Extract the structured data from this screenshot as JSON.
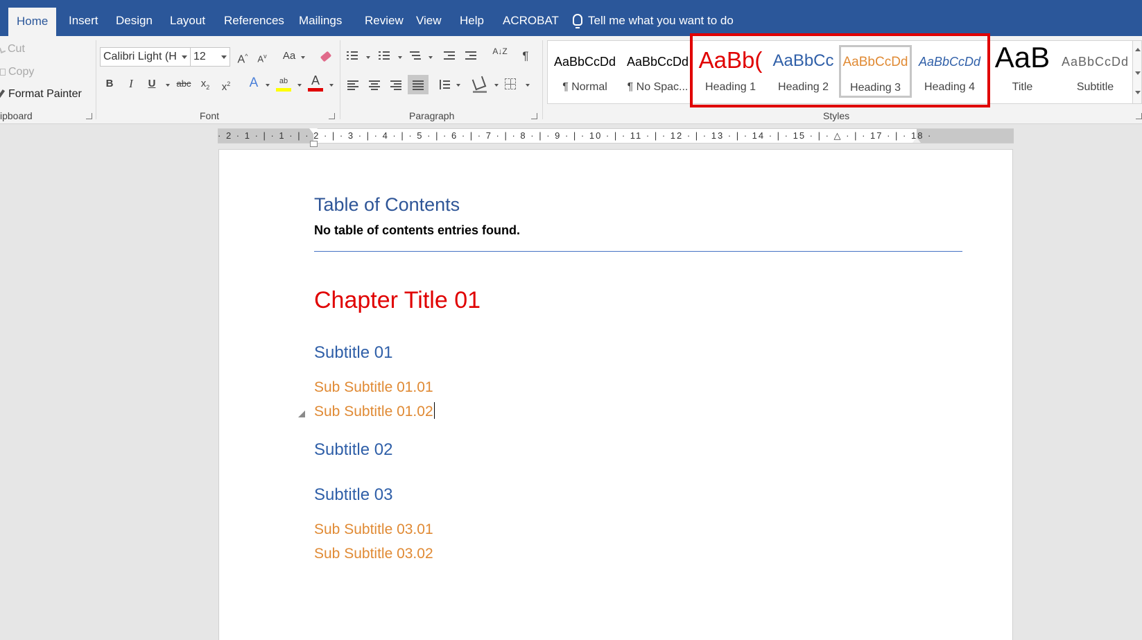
{
  "tabs": [
    "Home",
    "Insert",
    "Design",
    "Layout",
    "References",
    "Mailings",
    "Review",
    "View",
    "Help",
    "ACROBAT"
  ],
  "tell_me": "Tell me what you want to do",
  "clipboard": {
    "cut": "Cut",
    "copy": "Copy",
    "format_painter": "Format Painter",
    "group_label": "ipboard"
  },
  "font": {
    "name": "Calibri Light (H",
    "size": "12",
    "grow": "A",
    "shrink": "A",
    "case": "Aa",
    "bold": "B",
    "italic": "I",
    "underline": "U",
    "strike": "abc",
    "subscript": "x",
    "sub_mark": "2",
    "superscript": "x",
    "sup_mark": "2",
    "effects": "A",
    "highlight": "ab",
    "color": "A",
    "group_label": "Font"
  },
  "paragraph": {
    "sort": "A↓Z",
    "pilcrow": "¶",
    "group_label": "Paragraph"
  },
  "styles": {
    "group_label": "Styles",
    "items": [
      {
        "sample": "AaBbCcDd",
        "label": "¶ Normal"
      },
      {
        "sample": "AaBbCcDd",
        "label": "¶ No Spac..."
      },
      {
        "sample": "AaBb(",
        "label": "Heading 1"
      },
      {
        "sample": "AaBbCc",
        "label": "Heading 2"
      },
      {
        "sample": "AaBbCcDd",
        "label": "Heading 3"
      },
      {
        "sample": "AaBbCcDd",
        "label": "Heading 4"
      },
      {
        "sample": "AaB",
        "label": "Title"
      },
      {
        "sample": "AaBbCcDd",
        "label": "Subtitle"
      }
    ]
  },
  "ruler": {
    "labels": "· 2 · 1 · | · 1 · | · 2 · | · 3 · | · 4 · | · 5 · | · 6 · | · 7 · | · 8 · | · 9 · | · 10 · | · 11 · | · 12 · | · 13 · | · 14 · | · 15 · | · △ · | · 17 · | · 18 ·"
  },
  "document": {
    "toc_title": "Table of Contents",
    "toc_note": "No table of contents entries found.",
    "chapter_title": "Chapter Title 01",
    "subtitle_01": "Subtitle 01",
    "sub_01_01": "Sub Subtitle 01.01",
    "sub_01_02": "Sub Subtitle 01.02",
    "subtitle_02": "Subtitle 02",
    "subtitle_03": "Subtitle 03",
    "sub_03_01": "Sub Subtitle 03.01",
    "sub_03_02": "Sub Subtitle 03.02"
  },
  "colors": {
    "accent": "#2b579a",
    "heading1": "#e00000",
    "heading2": "#2f5fa8",
    "heading3": "#e08a34",
    "highlight_box": "#e00000"
  }
}
